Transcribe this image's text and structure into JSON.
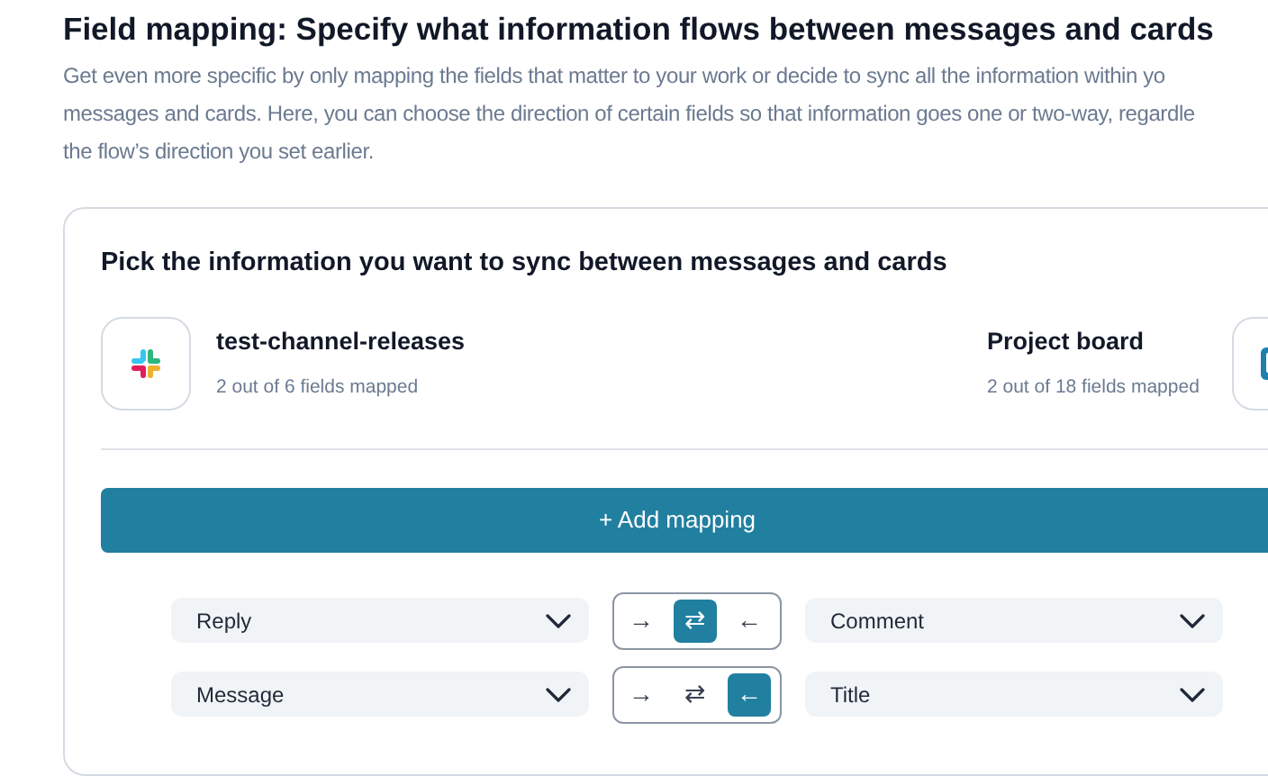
{
  "title": "Field mapping: Specify what information flows between messages and cards",
  "description_lines": [
    "Get even more specific by only mapping the fields that matter to your work or decide to sync all the information within yo",
    "messages and cards. Here, you can choose the direction of certain fields so that information goes one or two-way, regardle",
    "the flow’s direction you set earlier."
  ],
  "card": {
    "title": "Pick the information you want to sync between messages and cards",
    "source": {
      "name": "test-channel-releases",
      "caption": "2 out of 6 fields mapped"
    },
    "target": {
      "name": "Project board",
      "caption": "2 out of 18 fields mapped"
    },
    "add_button": "+ Add mapping",
    "mappings": [
      {
        "left": "Reply",
        "right": "Comment",
        "directions": [
          {
            "symbol": "→",
            "selected": false
          },
          {
            "symbol": "⇄",
            "selected": true
          },
          {
            "symbol": "←",
            "selected": false
          }
        ]
      },
      {
        "left": "Message",
        "right": "Title",
        "directions": [
          {
            "symbol": "→",
            "selected": false
          },
          {
            "symbol": "⇄",
            "selected": false
          },
          {
            "symbol": "←",
            "selected": true
          }
        ]
      }
    ]
  }
}
